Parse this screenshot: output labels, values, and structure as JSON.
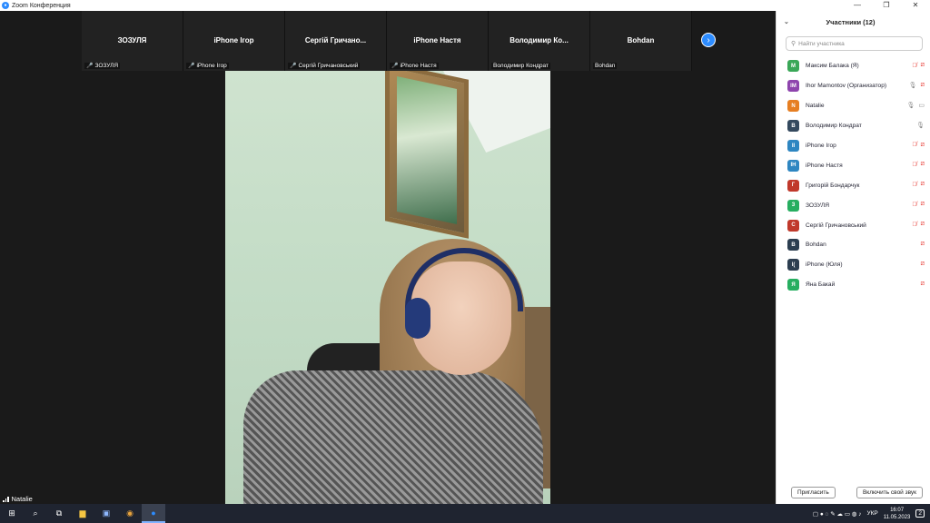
{
  "window": {
    "title": "Zoom Конференция",
    "controls": [
      "—",
      "❐",
      "✕"
    ]
  },
  "strip": {
    "tiles": [
      {
        "big": "ЗОЗУЛЯ",
        "small": "ЗОЗУЛЯ",
        "muted": true
      },
      {
        "big": "iPhone Ігор",
        "small": "iPhone Ігор",
        "muted": true
      },
      {
        "big": "Сергій  Гричано...",
        "small": "Сергій Гричановський",
        "muted": true
      },
      {
        "big": "iPhone Настя",
        "small": "iPhone Настя",
        "muted": true
      },
      {
        "big": "Володимир  Ко...",
        "small": "Володимир Кондрат",
        "muted": false
      },
      {
        "big": "Bohdan",
        "small": "Bohdan",
        "muted": false
      }
    ],
    "next_icon": "›"
  },
  "self_view": {
    "name": "Natalie"
  },
  "panel": {
    "title": "Участники (12)",
    "collapse_icon": "⌄",
    "search_placeholder": "Найти участника",
    "participants": [
      {
        "initial": "M",
        "color": "#3aa757",
        "name": "Максим Балака (Я)",
        "mic": "off",
        "video": "off"
      },
      {
        "initial": "IM",
        "color": "#8e44ad",
        "name": "Ihor Mamontov (Организатор)",
        "mic": "on",
        "video": "off"
      },
      {
        "initial": "N",
        "color": "#e67e22",
        "name": "Natalie",
        "mic": "on",
        "video": "on"
      },
      {
        "initial": "В",
        "color": "#34495e",
        "name": "Володимир Кондрат",
        "mic": "on",
        "video": "none"
      },
      {
        "initial": "II",
        "color": "#2e86c1",
        "name": "iPhone Ігор",
        "mic": "off",
        "video": "off"
      },
      {
        "initial": "IН",
        "color": "#2e86c1",
        "name": "iPhone Настя",
        "mic": "off",
        "video": "off"
      },
      {
        "initial": "Г",
        "color": "#c0392b",
        "name": "Григорій Бондарчук",
        "mic": "off",
        "video": "off"
      },
      {
        "initial": "З",
        "color": "#27ae60",
        "name": "ЗОЗУЛЯ",
        "mic": "off",
        "video": "off"
      },
      {
        "initial": "С",
        "color": "#c0392b",
        "name": "Сергій Гричановський",
        "mic": "off",
        "video": "off"
      },
      {
        "initial": "B",
        "color": "#2c3e50",
        "name": "Bohdan",
        "mic": "none",
        "video": "off"
      },
      {
        "initial": "I(",
        "color": "#2c3e50",
        "name": "iPhone (Юля)",
        "mic": "none",
        "video": "off"
      },
      {
        "initial": "Я",
        "color": "#27ae60",
        "name": "Яна Бакай",
        "mic": "none",
        "video": "off"
      }
    ],
    "invite_label": "Пригласить",
    "unmute_label": "Включить свой звук"
  },
  "taskbar": {
    "lang": "УКР",
    "time": "16:07",
    "date": "11.05.2023",
    "notif": "2"
  }
}
